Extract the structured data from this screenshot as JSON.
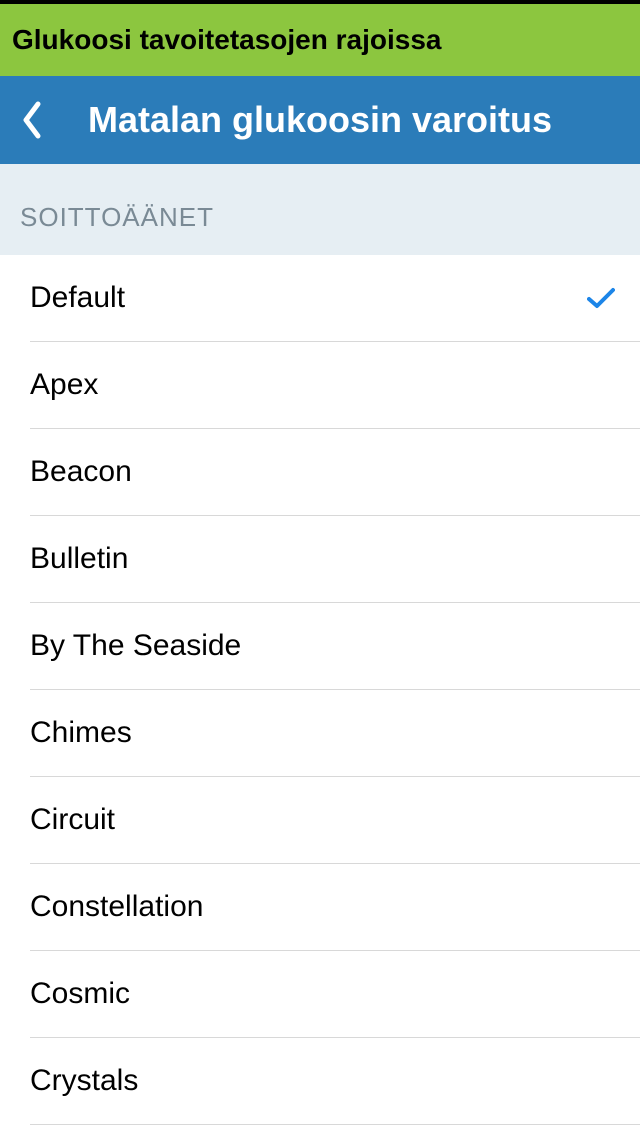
{
  "status_banner": "Glukoosi tavoitetasojen rajoissa",
  "nav_title": "Matalan glukoosin varoitus",
  "section_header": "SOITTOÄÄNET",
  "ringtones": [
    {
      "label": "Default",
      "selected": true
    },
    {
      "label": "Apex",
      "selected": false
    },
    {
      "label": "Beacon",
      "selected": false
    },
    {
      "label": "Bulletin",
      "selected": false
    },
    {
      "label": "By The Seaside",
      "selected": false
    },
    {
      "label": "Chimes",
      "selected": false
    },
    {
      "label": "Circuit",
      "selected": false
    },
    {
      "label": "Constellation",
      "selected": false
    },
    {
      "label": "Cosmic",
      "selected": false
    },
    {
      "label": "Crystals",
      "selected": false
    }
  ],
  "colors": {
    "green_banner": "#8cc63f",
    "blue_nav": "#2b7cb9",
    "section_bg": "#e6eef3",
    "section_text": "#7a8a95",
    "accent_blue": "#1c85e8"
  }
}
